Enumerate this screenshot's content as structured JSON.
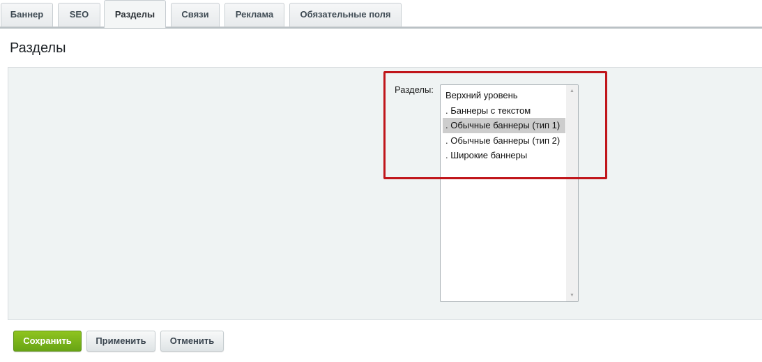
{
  "tabs": [
    {
      "label": "Баннер",
      "active": false
    },
    {
      "label": "SEO",
      "active": false
    },
    {
      "label": "Разделы",
      "active": true
    },
    {
      "label": "Связи",
      "active": false
    },
    {
      "label": "Реклама",
      "active": false
    },
    {
      "label": "Обязательные поля",
      "active": false
    }
  ],
  "page": {
    "title": "Разделы"
  },
  "sections_field": {
    "label": "Разделы:",
    "options": [
      {
        "label": "Верхний уровень",
        "selected": false
      },
      {
        "label": ". Баннеры с текстом",
        "selected": false
      },
      {
        "label": ". Обычные баннеры (тип 1)",
        "selected": true
      },
      {
        "label": ". Обычные баннеры (тип 2)",
        "selected": false
      },
      {
        "label": ". Широкие баннеры",
        "selected": false
      }
    ]
  },
  "buttons": {
    "save_label": "Сохранить",
    "apply_label": "Применить",
    "cancel_label": "Отменить"
  },
  "colors": {
    "highlight": "#c0151a",
    "save_button": "#7ab51b",
    "panel_background": "#eff3f3",
    "selected_option": "#cdcdcd"
  },
  "icons": {
    "scroll_up": "scroll-up-arrow-icon",
    "scroll_down": "scroll-down-arrow-icon"
  }
}
